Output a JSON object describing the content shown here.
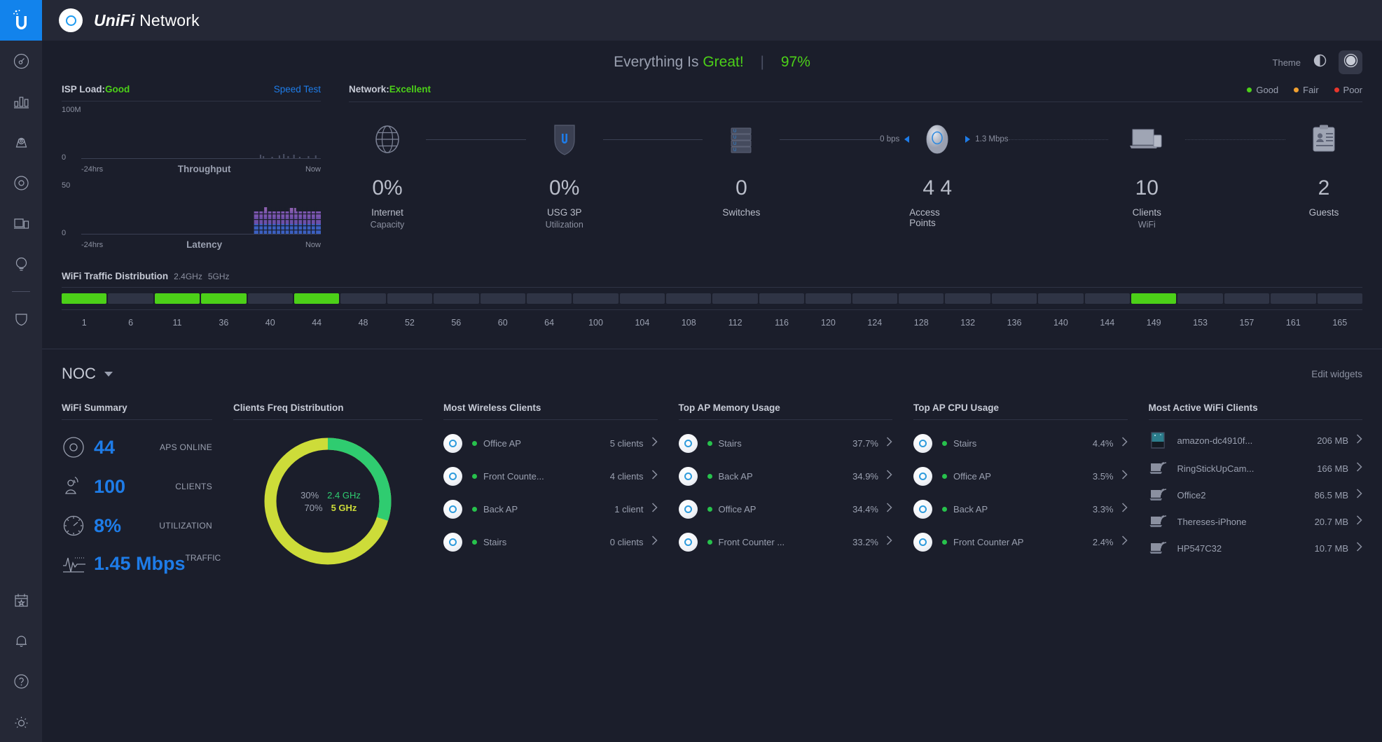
{
  "sidebar": {
    "logo_icon": "ubiquiti-logo-icon",
    "items": [
      {
        "name": "dashboard",
        "icon": "gauge-icon"
      },
      {
        "name": "statistics",
        "icon": "bar-chart-icon"
      },
      {
        "name": "map",
        "icon": "map-pin-icon"
      },
      {
        "name": "devices",
        "icon": "device-circle-icon"
      },
      {
        "name": "clients",
        "icon": "screens-icon"
      },
      {
        "name": "insights",
        "icon": "bulb-icon"
      },
      {
        "name": "security",
        "icon": "shield-icon"
      }
    ],
    "bottom_items": [
      {
        "name": "events",
        "icon": "calendar-star-icon"
      },
      {
        "name": "alerts",
        "icon": "bell-icon"
      },
      {
        "name": "help",
        "icon": "question-circle-icon"
      },
      {
        "name": "settings",
        "icon": "gear-icon"
      }
    ]
  },
  "topbar": {
    "app_icon": "unifi-ap-icon",
    "brand_italic": "UniFi",
    "brand_plain": " Network"
  },
  "status": {
    "message_prefix": "Everything Is ",
    "message_state": "Great!",
    "separator": "|",
    "percent": "97%",
    "theme_label": "Theme",
    "theme_light_icon": "contrast-half-icon",
    "theme_dark_icon": "filled-circle-icon"
  },
  "isp": {
    "title": "ISP Load: ",
    "state": "Good",
    "speed_test": "Speed Test",
    "throughput": {
      "ymax_label": "100M",
      "ymin_label": "0",
      "left_label": "-24hrs",
      "title": "Throughput",
      "right_label": "Now"
    },
    "latency": {
      "ymax_label": "50",
      "ymin_label": "0",
      "left_label": "-24hrs",
      "title": "Latency",
      "right_label": "Now"
    }
  },
  "network": {
    "title": "Network: ",
    "state": "Excellent",
    "legend": [
      {
        "label": "Good",
        "color": "#4cd018"
      },
      {
        "label": "Fair",
        "color": "#f0a030"
      },
      {
        "label": "Poor",
        "color": "#e8362c"
      }
    ],
    "down_rate": "0 bps",
    "up_rate": "1.3 Mbps",
    "nodes": [
      {
        "icon": "globe-icon",
        "value": "0%",
        "label": "Internet",
        "sub": "Capacity"
      },
      {
        "icon": "usg-shield-icon",
        "value": "0%",
        "label": "USG 3P",
        "sub": "Utilization"
      },
      {
        "icon": "switch-stack-icon",
        "value": "0",
        "label": "Switches",
        "sub": ""
      },
      {
        "icon": "access-point-icon",
        "value": "4 4",
        "label": "Access Points",
        "sub": ""
      },
      {
        "icon": "laptop-phone-icon",
        "value": "10",
        "label": "Clients",
        "sub": "WiFi"
      },
      {
        "icon": "guest-badge-icon",
        "value": "2",
        "label": "Guests",
        "sub": ""
      }
    ]
  },
  "wifi_traffic": {
    "title": "WiFi Traffic Distribution",
    "band_24": "2.4GHz",
    "band_5": "5GHz",
    "channels": [
      {
        "label": "1",
        "active": true
      },
      {
        "label": "6",
        "active": false
      },
      {
        "label": "11",
        "active": true
      },
      {
        "label": "36",
        "active": true
      },
      {
        "label": "40",
        "active": false
      },
      {
        "label": "44",
        "active": true
      },
      {
        "label": "48",
        "active": false
      },
      {
        "label": "52",
        "active": false
      },
      {
        "label": "56",
        "active": false
      },
      {
        "label": "60",
        "active": false
      },
      {
        "label": "64",
        "active": false
      },
      {
        "label": "100",
        "active": false
      },
      {
        "label": "104",
        "active": false
      },
      {
        "label": "108",
        "active": false
      },
      {
        "label": "112",
        "active": false
      },
      {
        "label": "116",
        "active": false
      },
      {
        "label": "120",
        "active": false
      },
      {
        "label": "124",
        "active": false
      },
      {
        "label": "128",
        "active": false
      },
      {
        "label": "132",
        "active": false
      },
      {
        "label": "136",
        "active": false
      },
      {
        "label": "140",
        "active": false
      },
      {
        "label": "144",
        "active": false
      },
      {
        "label": "149",
        "active": true
      },
      {
        "label": "153",
        "active": false
      },
      {
        "label": "157",
        "active": false
      },
      {
        "label": "161",
        "active": false
      },
      {
        "label": "165",
        "active": false
      }
    ]
  },
  "noc": {
    "title": "NOC",
    "dropdown_icon": "chevron-down-icon",
    "edit_widgets": "Edit widgets"
  },
  "widgets": {
    "wifi_summary": {
      "title": "WiFi Summary",
      "rows": [
        {
          "icon": "ap-ring-icon",
          "value": "44",
          "label": "APS ONLINE"
        },
        {
          "icon": "client-antenna-icon",
          "value": "100",
          "label": "CLIENTS"
        },
        {
          "icon": "gauge-meter-icon",
          "value": "8%",
          "label": "UTILIZATION"
        },
        {
          "icon": "waveform-icon",
          "value": "1.45 Mbps",
          "label": "TRAFFIC"
        }
      ]
    },
    "clients_freq": {
      "title": "Clients Freq Distribution",
      "slice_24_pct": "30%",
      "slice_24_label": "2.4 GHz",
      "slice_5_pct": "70%",
      "slice_5_label": "5 GHz"
    },
    "most_wireless_clients": {
      "title": "Most Wireless Clients",
      "rows": [
        {
          "name": "Office AP",
          "value": "5 clients",
          "status": "online"
        },
        {
          "name": "Front Counte...",
          "value": "4 clients",
          "status": "online"
        },
        {
          "name": "Back AP",
          "value": "1 client",
          "status": "online"
        },
        {
          "name": "Stairs",
          "value": "0 clients",
          "status": "online"
        }
      ]
    },
    "top_ap_memory": {
      "title": "Top AP Memory Usage",
      "rows": [
        {
          "name": "Stairs",
          "value": "37.7%",
          "status": "online"
        },
        {
          "name": "Back AP",
          "value": "34.9%",
          "status": "online"
        },
        {
          "name": "Office AP",
          "value": "34.4%",
          "status": "online"
        },
        {
          "name": "Front Counter ...",
          "value": "33.2%",
          "status": "online"
        }
      ]
    },
    "top_ap_cpu": {
      "title": "Top AP CPU Usage",
      "rows": [
        {
          "name": "Stairs",
          "value": "4.4%",
          "status": "online"
        },
        {
          "name": "Office AP",
          "value": "3.5%",
          "status": "online"
        },
        {
          "name": "Back AP",
          "value": "3.3%",
          "status": "online"
        },
        {
          "name": "Front Counter AP",
          "value": "2.4%",
          "status": "online"
        }
      ]
    },
    "most_active_clients": {
      "title": "Most Active WiFi Clients",
      "rows": [
        {
          "name": "amazon-dc4910f...",
          "value": "206 MB",
          "icon": "tablet-screen-icon"
        },
        {
          "name": "RingStickUpCam...",
          "value": "166 MB",
          "icon": "laptop-wifi-icon"
        },
        {
          "name": "Office2",
          "value": "86.5 MB",
          "icon": "laptop-wifi-icon"
        },
        {
          "name": "Thereses-iPhone",
          "value": "20.7 MB",
          "icon": "laptop-wifi-icon"
        },
        {
          "name": "HP547C32",
          "value": "10.7 MB",
          "icon": "laptop-wifi-icon"
        }
      ]
    }
  },
  "chart_data": {
    "type": "pie",
    "title": "Clients Freq Distribution",
    "categories": [
      "2.4 GHz",
      "5 GHz"
    ],
    "values": [
      30,
      70
    ],
    "colors": [
      "#2fcc70",
      "#cddc39"
    ],
    "legend": "center"
  }
}
